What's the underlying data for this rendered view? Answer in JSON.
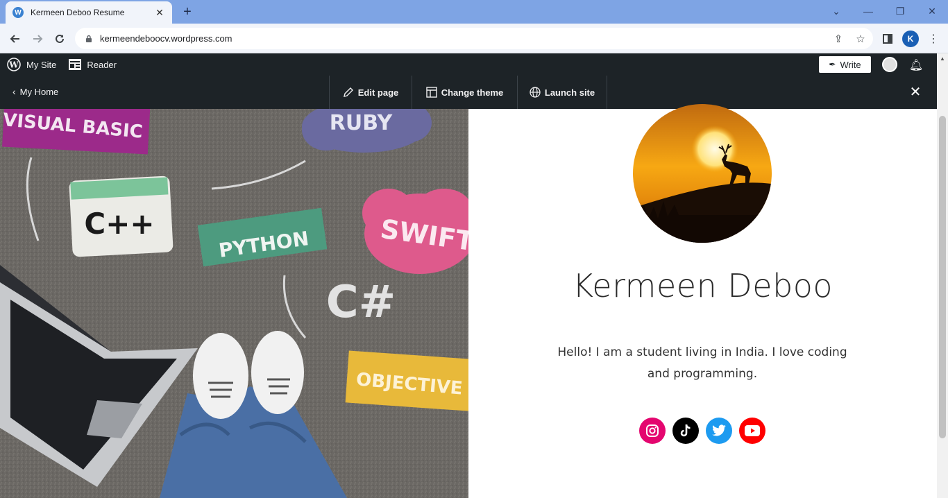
{
  "browser": {
    "tab_title": "Kermeen Deboo Resume",
    "url": "kermeendeboocv.wordpress.com",
    "profile_initial": "K"
  },
  "wp_admin_bar": {
    "my_site": "My Site",
    "reader": "Reader",
    "write": "Write"
  },
  "editor_bar": {
    "my_home": "My Home",
    "edit_page": "Edit page",
    "change_theme": "Change theme",
    "launch_site": "Launch site"
  },
  "hero": {
    "stickers": [
      "VISUAL BASIC",
      "RUBY",
      "C++",
      "PYTHON",
      "SWIFT",
      "C#",
      "OBJECTIVE"
    ]
  },
  "profile": {
    "name": "Kermeen Deboo",
    "bio": "Hello! I am a student living in India. I love coding and programming.",
    "socials": [
      {
        "name": "instagram",
        "color": "#e4066f"
      },
      {
        "name": "tiktok",
        "color": "#000000"
      },
      {
        "name": "twitter",
        "color": "#1d9bf0"
      },
      {
        "name": "youtube",
        "color": "#ff0000"
      }
    ]
  },
  "colors": {
    "tabstrip": "#7ea4e4",
    "admin_bar": "#1d2327"
  }
}
